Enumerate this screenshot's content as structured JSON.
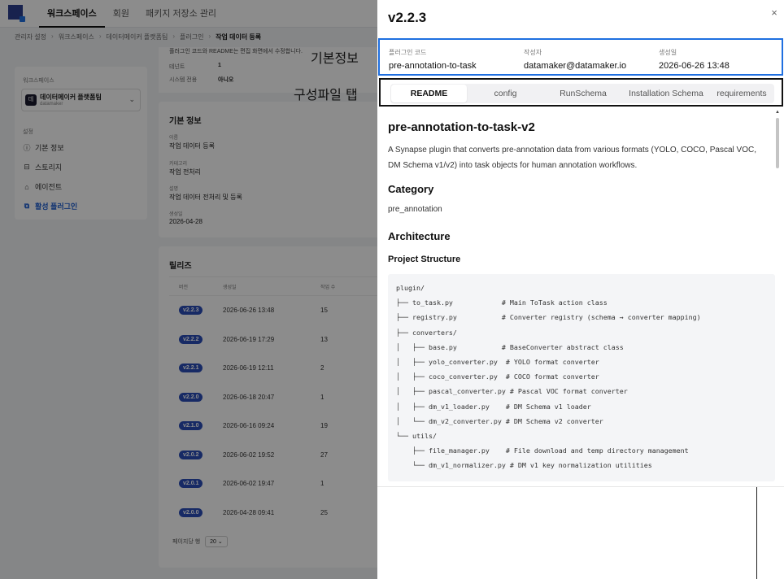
{
  "topnav": {
    "tabs": [
      "워크스페이스",
      "회원",
      "패키지 저장소 관리"
    ]
  },
  "breadcrumb": [
    "관리자 설정",
    "워크스페이스",
    "데이터메이커 플랫폼팀",
    "플러그인",
    "작업 데이터 등록"
  ],
  "sidebar": {
    "workspace_label": "워크스페이스",
    "workspace_badge": "데",
    "workspace_name": "데이터메이커 플랫폼팀",
    "workspace_sub": "datamaker",
    "settings_label": "설정",
    "items": [
      {
        "label": "기본 정보",
        "icon": "info-icon"
      },
      {
        "label": "스토리지",
        "icon": "storage-icon"
      },
      {
        "label": "에이전트",
        "icon": "agent-icon"
      },
      {
        "label": "활성 플러그인",
        "icon": "plugin-icon"
      }
    ]
  },
  "main_top": {
    "note": "플러그인 코드와 README는 편집 화면에서 수정합니다.",
    "rows": [
      {
        "k": "테넌트",
        "v": "1"
      },
      {
        "k": "시스템 전용",
        "v": "아니오"
      }
    ]
  },
  "info_card": {
    "title": "기본 정보",
    "fields": [
      {
        "label": "이름",
        "value": "작업 데이터 등록"
      },
      {
        "label": "카테고리",
        "value": "작업 전처리"
      },
      {
        "label": "설명",
        "value": "작업 데이터 전처리 및 등록"
      },
      {
        "label": "생성일",
        "value": "2026-04-28"
      }
    ]
  },
  "releases": {
    "title": "릴리즈",
    "headers": [
      "버전",
      "생성일",
      "작업 수"
    ],
    "rows": [
      {
        "version": "v2.2.3",
        "created": "2026-06-26 13:48",
        "tasks": "15"
      },
      {
        "version": "v2.2.2",
        "created": "2026-06-19 17:29",
        "tasks": "13"
      },
      {
        "version": "v2.2.1",
        "created": "2026-06-19 12:11",
        "tasks": "2"
      },
      {
        "version": "v2.2.0",
        "created": "2026-06-18 20:47",
        "tasks": "1"
      },
      {
        "version": "v2.1.0",
        "created": "2026-06-16 09:24",
        "tasks": "19"
      },
      {
        "version": "v2.0.2",
        "created": "2026-06-02 19:52",
        "tasks": "27"
      },
      {
        "version": "v2.0.1",
        "created": "2026-06-02 19:47",
        "tasks": "1"
      },
      {
        "version": "v2.0.0",
        "created": "2026-04-28 09:41",
        "tasks": "25"
      }
    ],
    "pager_label": "페이지당 행",
    "pager_value": "20"
  },
  "drawer": {
    "title": "v2.2.3",
    "close": "×",
    "meta": [
      {
        "label": "플러그인 코드",
        "value": "pre-annotation-to-task"
      },
      {
        "label": "작성자",
        "value": "datamaker@datamaker.io"
      },
      {
        "label": "생성일",
        "value": "2026-06-26 13:48"
      }
    ],
    "tabs": [
      "README",
      "config",
      "RunSchema",
      "Installation Schema",
      "requirements"
    ],
    "active_tab": "README",
    "readme": {
      "h1": "pre-annotation-to-task-v2",
      "desc": "A Synapse plugin that converts pre-annotation data from various formats (YOLO, COCO, Pascal VOC, DM Schema v1/v2) into task objects for human annotation workflows.",
      "category_heading": "Category",
      "category": "pre_annotation",
      "architecture_heading": "Architecture",
      "structure_heading": "Project Structure",
      "code_lines": [
        "plugin/",
        "├── to_task.py            # Main ToTask action class",
        "├── registry.py           # Converter registry (schema → converter mapping)",
        "├── converters/",
        "│   ├── base.py           # BaseConverter abstract class",
        "│   ├── yolo_converter.py  # YOLO format converter",
        "│   ├── coco_converter.py  # COCO format converter",
        "│   ├── pascal_converter.py # Pascal VOC format converter",
        "│   ├── dm_v1_loader.py    # DM Schema v1 loader",
        "│   └── dm_v2_converter.py # DM Schema v2 converter",
        "└── utils/",
        "    ├── file_manager.py    # File download and temp directory management",
        "    └── dm_v1_normalizer.py # DM v1 key normalization utilities"
      ]
    }
  },
  "annotations": {
    "basic_info": "기본정보",
    "config_tab": "구성파일 탭"
  },
  "colors": {
    "accent": "#1f6fe0",
    "badge": "#2a4db8",
    "tab_box": "#111111"
  }
}
